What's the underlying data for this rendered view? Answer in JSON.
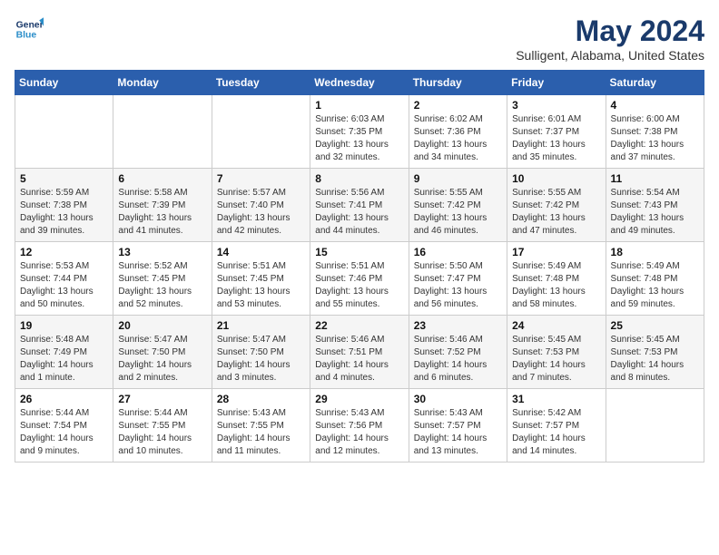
{
  "header": {
    "logo_line1": "General",
    "logo_line2": "Blue",
    "title": "May 2024",
    "location": "Sulligent, Alabama, United States"
  },
  "weekdays": [
    "Sunday",
    "Monday",
    "Tuesday",
    "Wednesday",
    "Thursday",
    "Friday",
    "Saturday"
  ],
  "weeks": [
    [
      {
        "day": "",
        "info": ""
      },
      {
        "day": "",
        "info": ""
      },
      {
        "day": "",
        "info": ""
      },
      {
        "day": "1",
        "info": "Sunrise: 6:03 AM\nSunset: 7:35 PM\nDaylight: 13 hours\nand 32 minutes."
      },
      {
        "day": "2",
        "info": "Sunrise: 6:02 AM\nSunset: 7:36 PM\nDaylight: 13 hours\nand 34 minutes."
      },
      {
        "day": "3",
        "info": "Sunrise: 6:01 AM\nSunset: 7:37 PM\nDaylight: 13 hours\nand 35 minutes."
      },
      {
        "day": "4",
        "info": "Sunrise: 6:00 AM\nSunset: 7:38 PM\nDaylight: 13 hours\nand 37 minutes."
      }
    ],
    [
      {
        "day": "5",
        "info": "Sunrise: 5:59 AM\nSunset: 7:38 PM\nDaylight: 13 hours\nand 39 minutes."
      },
      {
        "day": "6",
        "info": "Sunrise: 5:58 AM\nSunset: 7:39 PM\nDaylight: 13 hours\nand 41 minutes."
      },
      {
        "day": "7",
        "info": "Sunrise: 5:57 AM\nSunset: 7:40 PM\nDaylight: 13 hours\nand 42 minutes."
      },
      {
        "day": "8",
        "info": "Sunrise: 5:56 AM\nSunset: 7:41 PM\nDaylight: 13 hours\nand 44 minutes."
      },
      {
        "day": "9",
        "info": "Sunrise: 5:55 AM\nSunset: 7:42 PM\nDaylight: 13 hours\nand 46 minutes."
      },
      {
        "day": "10",
        "info": "Sunrise: 5:55 AM\nSunset: 7:42 PM\nDaylight: 13 hours\nand 47 minutes."
      },
      {
        "day": "11",
        "info": "Sunrise: 5:54 AM\nSunset: 7:43 PM\nDaylight: 13 hours\nand 49 minutes."
      }
    ],
    [
      {
        "day": "12",
        "info": "Sunrise: 5:53 AM\nSunset: 7:44 PM\nDaylight: 13 hours\nand 50 minutes."
      },
      {
        "day": "13",
        "info": "Sunrise: 5:52 AM\nSunset: 7:45 PM\nDaylight: 13 hours\nand 52 minutes."
      },
      {
        "day": "14",
        "info": "Sunrise: 5:51 AM\nSunset: 7:45 PM\nDaylight: 13 hours\nand 53 minutes."
      },
      {
        "day": "15",
        "info": "Sunrise: 5:51 AM\nSunset: 7:46 PM\nDaylight: 13 hours\nand 55 minutes."
      },
      {
        "day": "16",
        "info": "Sunrise: 5:50 AM\nSunset: 7:47 PM\nDaylight: 13 hours\nand 56 minutes."
      },
      {
        "day": "17",
        "info": "Sunrise: 5:49 AM\nSunset: 7:48 PM\nDaylight: 13 hours\nand 58 minutes."
      },
      {
        "day": "18",
        "info": "Sunrise: 5:49 AM\nSunset: 7:48 PM\nDaylight: 13 hours\nand 59 minutes."
      }
    ],
    [
      {
        "day": "19",
        "info": "Sunrise: 5:48 AM\nSunset: 7:49 PM\nDaylight: 14 hours\nand 1 minute."
      },
      {
        "day": "20",
        "info": "Sunrise: 5:47 AM\nSunset: 7:50 PM\nDaylight: 14 hours\nand 2 minutes."
      },
      {
        "day": "21",
        "info": "Sunrise: 5:47 AM\nSunset: 7:50 PM\nDaylight: 14 hours\nand 3 minutes."
      },
      {
        "day": "22",
        "info": "Sunrise: 5:46 AM\nSunset: 7:51 PM\nDaylight: 14 hours\nand 4 minutes."
      },
      {
        "day": "23",
        "info": "Sunrise: 5:46 AM\nSunset: 7:52 PM\nDaylight: 14 hours\nand 6 minutes."
      },
      {
        "day": "24",
        "info": "Sunrise: 5:45 AM\nSunset: 7:53 PM\nDaylight: 14 hours\nand 7 minutes."
      },
      {
        "day": "25",
        "info": "Sunrise: 5:45 AM\nSunset: 7:53 PM\nDaylight: 14 hours\nand 8 minutes."
      }
    ],
    [
      {
        "day": "26",
        "info": "Sunrise: 5:44 AM\nSunset: 7:54 PM\nDaylight: 14 hours\nand 9 minutes."
      },
      {
        "day": "27",
        "info": "Sunrise: 5:44 AM\nSunset: 7:55 PM\nDaylight: 14 hours\nand 10 minutes."
      },
      {
        "day": "28",
        "info": "Sunrise: 5:43 AM\nSunset: 7:55 PM\nDaylight: 14 hours\nand 11 minutes."
      },
      {
        "day": "29",
        "info": "Sunrise: 5:43 AM\nSunset: 7:56 PM\nDaylight: 14 hours\nand 12 minutes."
      },
      {
        "day": "30",
        "info": "Sunrise: 5:43 AM\nSunset: 7:57 PM\nDaylight: 14 hours\nand 13 minutes."
      },
      {
        "day": "31",
        "info": "Sunrise: 5:42 AM\nSunset: 7:57 PM\nDaylight: 14 hours\nand 14 minutes."
      },
      {
        "day": "",
        "info": ""
      }
    ]
  ]
}
